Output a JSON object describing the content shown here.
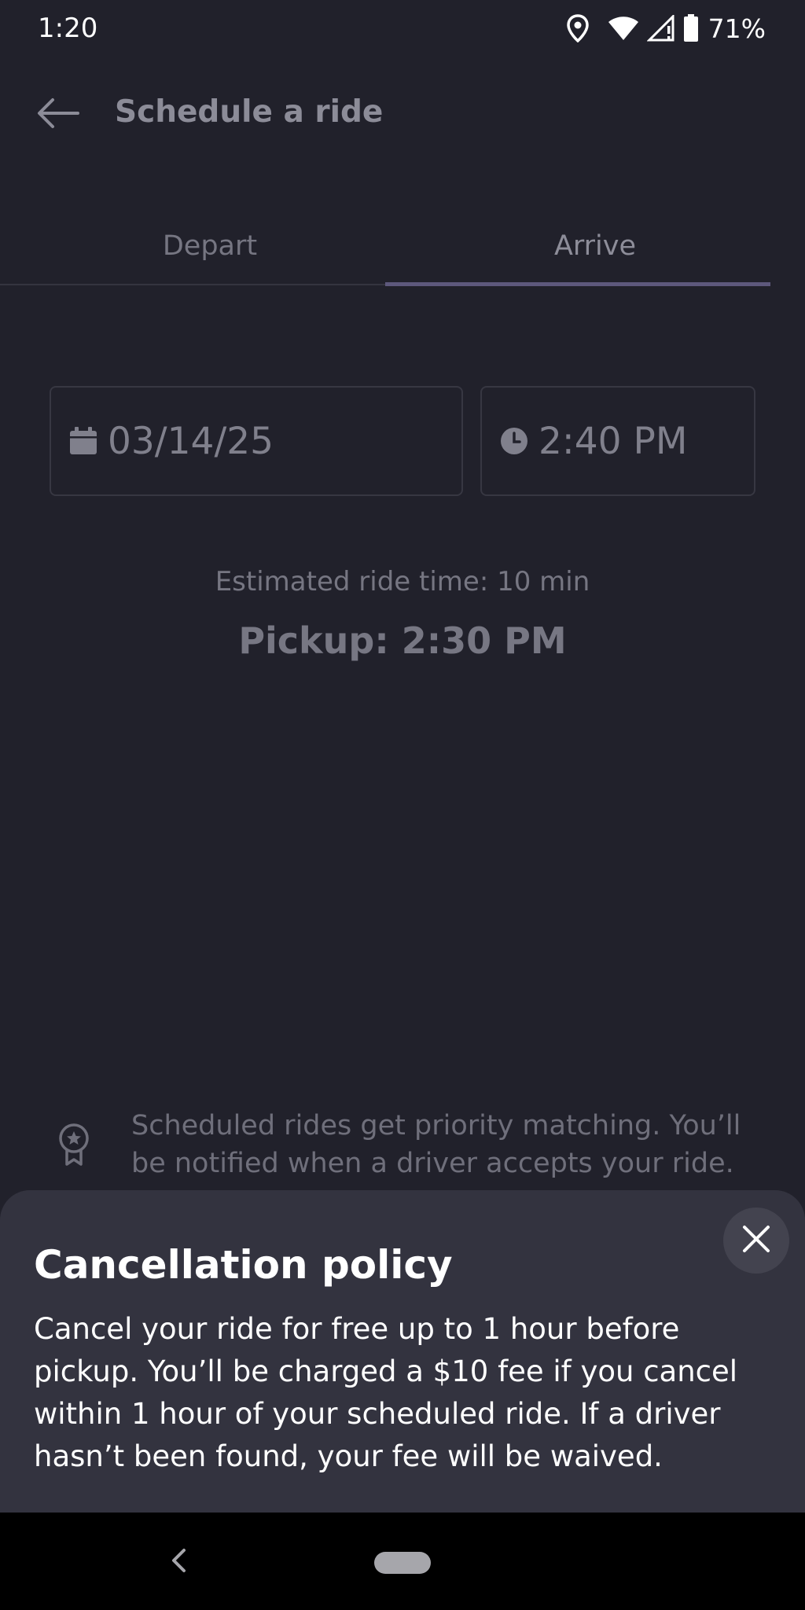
{
  "status_bar": {
    "time": "1:20",
    "battery_percent": "71%",
    "icons": [
      "location-icon",
      "wifi-icon",
      "cell-signal-icon",
      "battery-icon"
    ]
  },
  "header": {
    "title": "Schedule a ride",
    "back_icon": "arrow-left-icon"
  },
  "tabs": [
    {
      "label": "Depart",
      "selected": false
    },
    {
      "label": "Arrive",
      "selected": true
    }
  ],
  "date_field": {
    "value": "03/14/25",
    "icon": "calendar-icon"
  },
  "time_field": {
    "value": "2:40 PM",
    "icon": "clock-icon"
  },
  "estimate_text": "Estimated ride time: 10 min",
  "pickup_text": "Pickup: 2:30 PM",
  "priority_note": {
    "icon": "award-badge-icon",
    "text": "Scheduled rides get priority matching. You’ll be notified when a driver accepts your ride."
  },
  "cancellation_sheet": {
    "title": "Cancellation policy",
    "body": "Cancel your ride for free up to 1 hour before pickup. You’ll be charged a $10 fee if you cancel within 1 hour of your scheduled ride. If a driver hasn’t been found, your fee will be waived.",
    "close_icon": "close-icon"
  },
  "colors": {
    "background": "#21212b",
    "sheet_background": "#33333f",
    "tab_indicator": "#5d587c",
    "nav_bar": "#000000"
  }
}
